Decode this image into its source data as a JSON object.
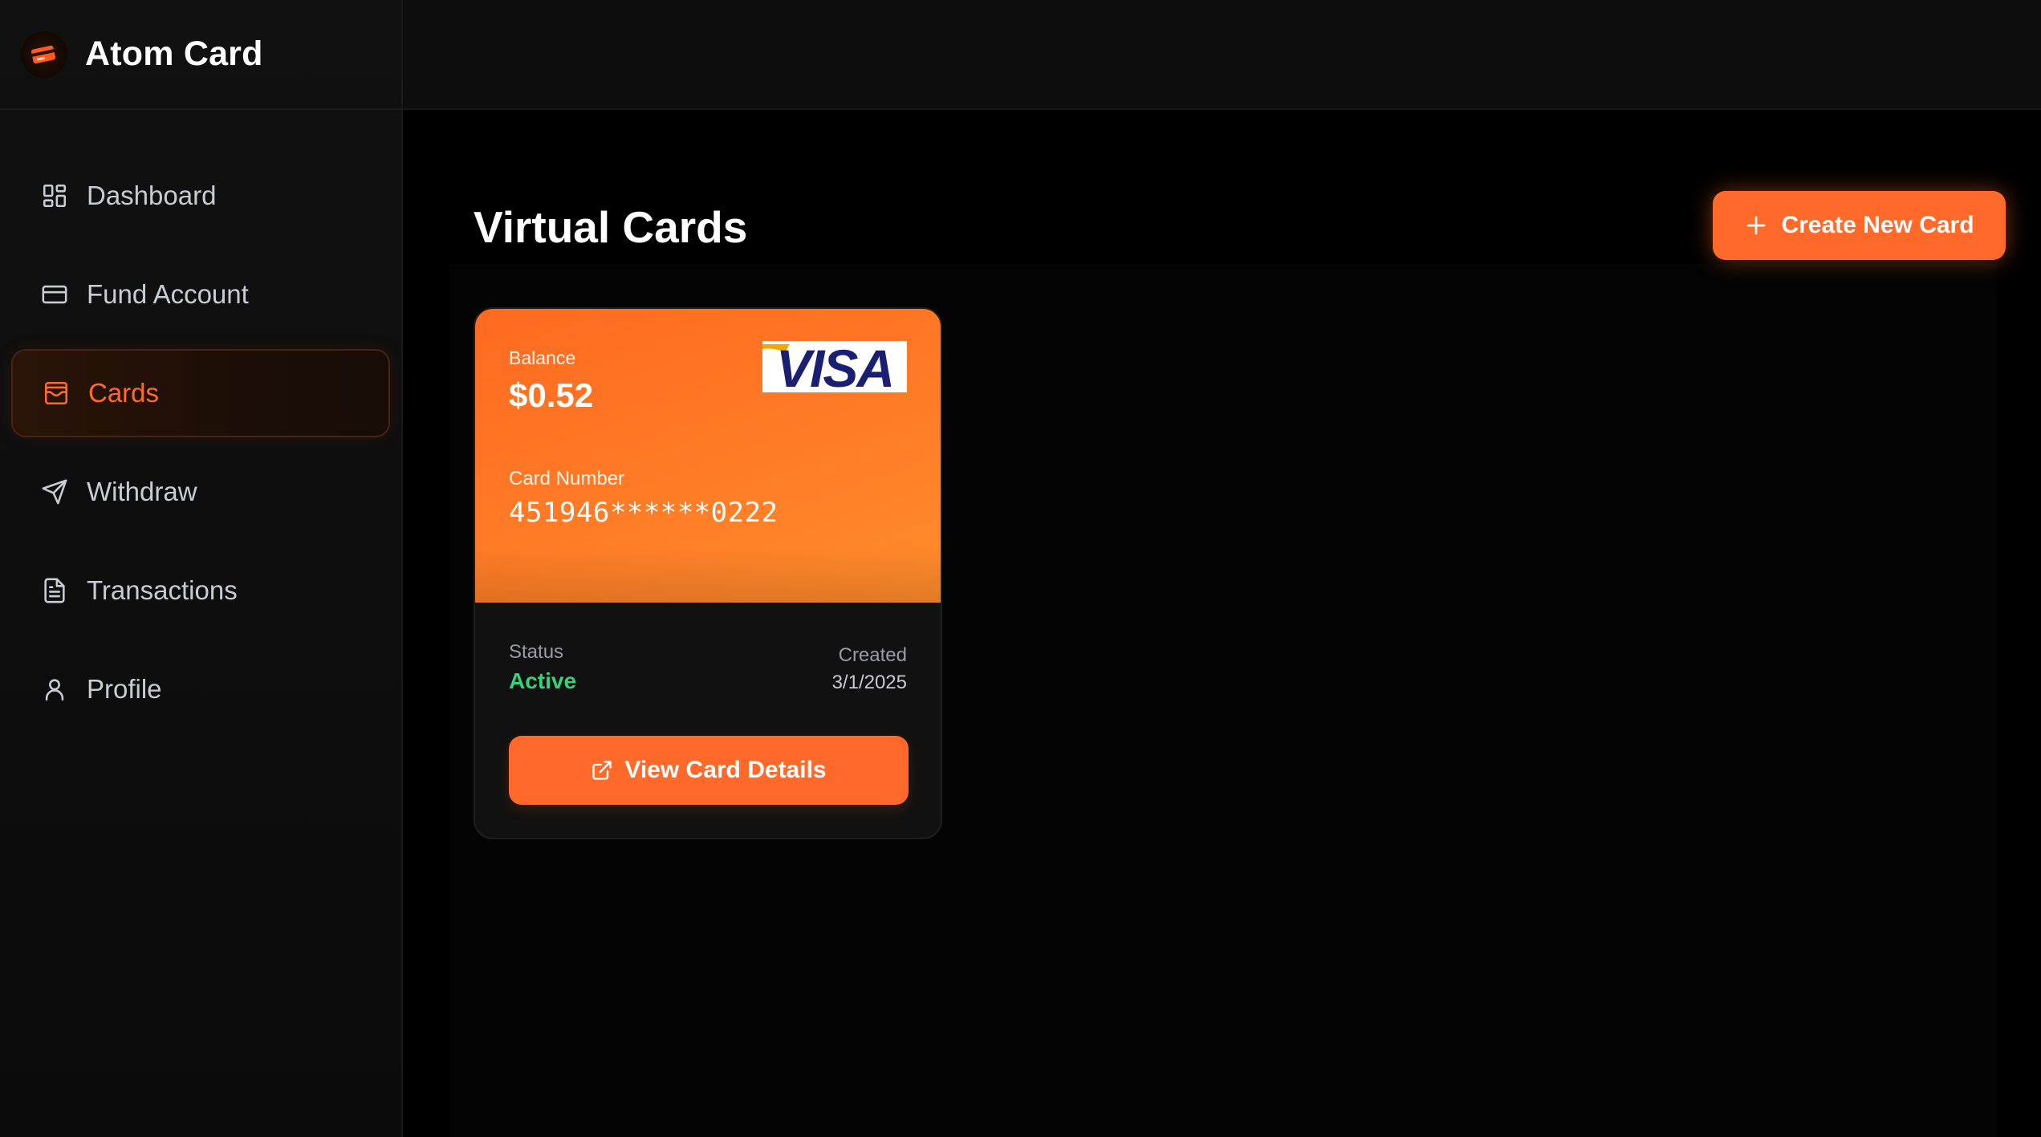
{
  "app": {
    "name": "Atom Card",
    "logo_icon": "card-logo-icon"
  },
  "sidebar": {
    "items": [
      {
        "label": "Dashboard",
        "icon": "grid-icon",
        "active": false
      },
      {
        "label": "Fund Account",
        "icon": "credit-card-icon",
        "active": false
      },
      {
        "label": "Cards",
        "icon": "wallet-card-icon",
        "active": true
      },
      {
        "label": "Withdraw",
        "icon": "send-icon",
        "active": false
      },
      {
        "label": "Transactions",
        "icon": "document-icon",
        "active": false
      },
      {
        "label": "Profile",
        "icon": "user-icon",
        "active": false
      }
    ]
  },
  "main": {
    "title": "Virtual Cards",
    "create_button": {
      "label": "Create New Card",
      "icon": "plus-icon"
    },
    "cards": [
      {
        "balance_label": "Balance",
        "balance": "$0.52",
        "brand": "VISA",
        "card_number_label": "Card Number",
        "card_number": "451946******0222",
        "status_label": "Status",
        "status": "Active",
        "created_label": "Created",
        "created": "3/1/2025",
        "details_button": {
          "label": "View Card Details",
          "icon": "external-link-icon"
        }
      }
    ]
  },
  "colors": {
    "accent": "#ff6a2a",
    "status_active": "#34d37a",
    "background": "#000000",
    "sidebar": "#111111",
    "visa_blue": "#1a1f71",
    "visa_gold": "#f7a600"
  }
}
